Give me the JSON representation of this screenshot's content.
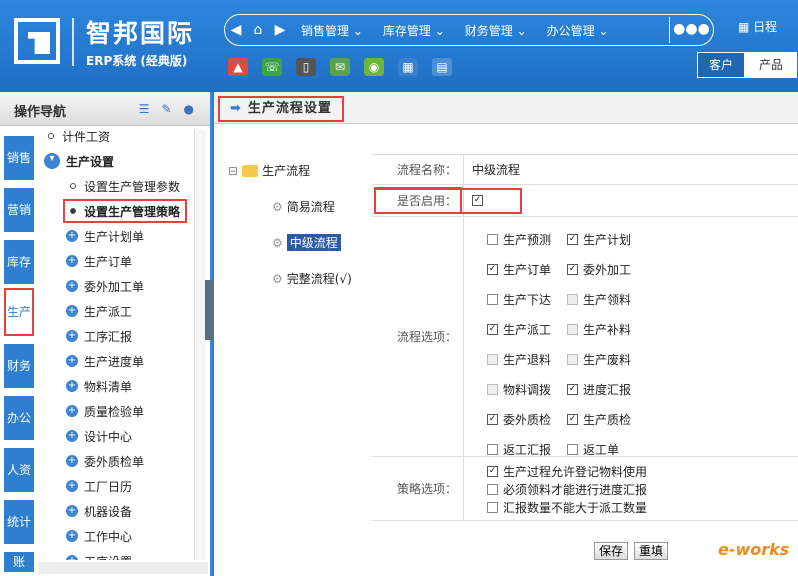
{
  "header": {
    "brand": "智邦国际",
    "brand_sub": "ERP系统 (经典版)",
    "schedule": "日程",
    "menu": [
      "销售管理",
      "库存管理",
      "财务管理",
      "办公管理"
    ],
    "tabs": [
      "客户",
      "产品"
    ],
    "tools": [
      "megaphone-icon",
      "phone-icon",
      "mobile-icon",
      "mail-icon",
      "chat-icon",
      "grid-icon",
      "book-icon"
    ]
  },
  "sidebar": {
    "title": "操作导航",
    "vtabs": [
      "销售",
      "营销",
      "库存",
      "生产",
      "财务",
      "办公",
      "人资",
      "统计",
      "账"
    ],
    "tree": [
      {
        "text": "计件工资",
        "type": "dot"
      },
      {
        "text": "生产设置",
        "type": "open"
      },
      {
        "text": "设置生产管理参数",
        "type": "sub"
      },
      {
        "text": "设置生产管理策略",
        "type": "subsel"
      },
      {
        "text": "生产计划单",
        "type": "plus"
      },
      {
        "text": "生产订单",
        "type": "plus"
      },
      {
        "text": "委外加工单",
        "type": "plus"
      },
      {
        "text": "生产派工",
        "type": "plus"
      },
      {
        "text": "工序汇报",
        "type": "plus"
      },
      {
        "text": "生产进度单",
        "type": "plus"
      },
      {
        "text": "物料清单",
        "type": "plus"
      },
      {
        "text": "质量检验单",
        "type": "plus"
      },
      {
        "text": "设计中心",
        "type": "plus"
      },
      {
        "text": "委外质检单",
        "type": "plus"
      },
      {
        "text": "工厂日历",
        "type": "plus"
      },
      {
        "text": "机器设备",
        "type": "plus"
      },
      {
        "text": "工作中心",
        "type": "plus"
      },
      {
        "text": "工序设置",
        "type": "plus"
      }
    ]
  },
  "main": {
    "title": "生产流程设置",
    "flow": {
      "root": "生产流程",
      "items": [
        "简易流程",
        "中级流程",
        "完整流程(√)"
      ]
    },
    "form": {
      "name_label": "流程名称：",
      "name_value": "中级流程",
      "enable_label": "是否启用：",
      "options_label": "流程选项：",
      "strategy_label": "策略选项：",
      "options": [
        [
          "生产预测",
          false,
          true
        ],
        [
          "生产计划",
          true,
          true
        ],
        [
          "生产订单",
          true,
          true
        ],
        [
          "委外加工",
          true,
          true
        ],
        [
          "生产下达",
          false,
          true
        ],
        [
          "生产领料",
          false,
          false
        ],
        [
          "生产派工",
          true,
          true
        ],
        [
          "生产补料",
          false,
          false
        ],
        [
          "生产退料",
          false,
          false
        ],
        [
          "生产废料",
          false,
          false
        ],
        [
          "物料调拨",
          false,
          false
        ],
        [
          "进度汇报",
          true,
          true
        ],
        [
          "委外质检",
          true,
          true
        ],
        [
          "生产质检",
          true,
          true
        ],
        [
          "返工汇报",
          false,
          true
        ],
        [
          "返工单",
          false,
          true
        ]
      ],
      "strategies": [
        [
          "生产过程允许登记物料使用",
          true
        ],
        [
          "必须领料才能进行进度汇报",
          false
        ],
        [
          "汇报数量不能大于派工数量",
          false
        ]
      ]
    },
    "save": "保存",
    "reset": "重填"
  },
  "watermark": "e-works"
}
